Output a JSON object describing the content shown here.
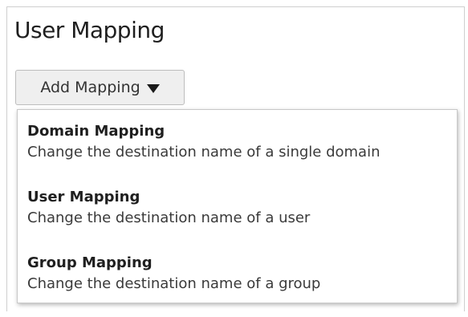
{
  "page": {
    "title": "User Mapping"
  },
  "add_mapping": {
    "label": "Add Mapping",
    "caret_icon": "caret-down-icon"
  },
  "menu": {
    "items": [
      {
        "title": "Domain Mapping",
        "description": "Change the destination name of a single domain"
      },
      {
        "title": "User Mapping",
        "description": "Change the destination name of a user"
      },
      {
        "title": "Group Mapping",
        "description": "Change the destination name of a group"
      }
    ]
  }
}
